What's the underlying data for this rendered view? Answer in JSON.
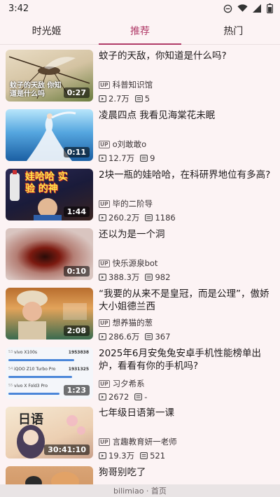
{
  "status": {
    "time": "3:42"
  },
  "tabs": [
    {
      "label": "时光姬",
      "active": false
    },
    {
      "label": "推荐",
      "active": true
    },
    {
      "label": "热门",
      "active": false
    }
  ],
  "up_badge": "UP",
  "videos": [
    {
      "title": "蚊子的天敌，你知道是什么吗?",
      "author": "科普知识馆",
      "views": "2.7万",
      "danmaku": "5",
      "duration": "0:27",
      "thumb_text": "蚊子的天敌 你知道是什么吗"
    },
    {
      "title": "凌晨四点 我看见海棠花未眠",
      "author": "o刘敢敢o",
      "views": "12.7万",
      "danmaku": "9",
      "duration": "0:11"
    },
    {
      "title": "2块一瓶的娃哈哈，在科研界地位有多高?",
      "author": "毕的二阶导",
      "views": "260.2万",
      "danmaku": "1186",
      "duration": "1:44",
      "thumb_text": "娃哈哈 实验 的神"
    },
    {
      "title": "还以为是一个洞",
      "author": "快乐源泉bot",
      "views": "388.3万",
      "danmaku": "982",
      "duration": "0:10"
    },
    {
      "title": "“我要的从来不是皇冠，而是公理”，傲娇大小姐德兰西",
      "author": "想养猫的葱",
      "views": "286.6万",
      "danmaku": "367",
      "duration": "2:08"
    },
    {
      "title": "2025年6月安兔兔安卓手机性能榜单出炉，看看有你的手机吗?",
      "author": "习夕希系",
      "views": "2672",
      "danmaku": "-",
      "duration": "1:23",
      "benchmark": [
        {
          "rank": "53",
          "name": "vivo X100s",
          "score": "1953838"
        },
        {
          "rank": "54",
          "name": "iQOO Z10 Turbo Pro",
          "score": "1931325"
        },
        {
          "rank": "55",
          "name": "vivo X Fold3 Pro",
          "score": ""
        }
      ]
    },
    {
      "title": "七年级日语第一课",
      "author": "言趣教育妍一老师",
      "views": "19.3万",
      "danmaku": "521",
      "duration": "30:41:10",
      "thumb_text": "日语"
    },
    {
      "title": "狗哥别吃了",
      "author": "",
      "views": "",
      "danmaku": "",
      "duration": ""
    }
  ],
  "footer": {
    "label": "bilimiao · 首页"
  }
}
